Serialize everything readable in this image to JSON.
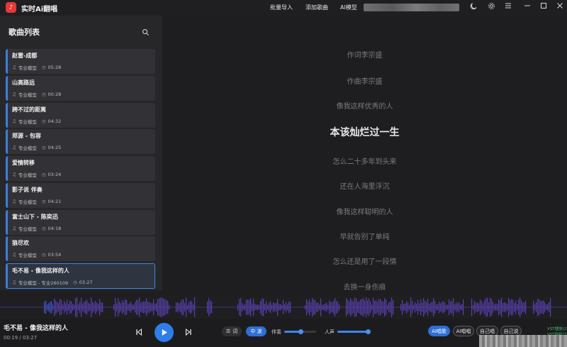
{
  "app": {
    "title": "实时Ai翻唱",
    "menu": [
      "批量导入",
      "添加歌曲",
      "AI模型"
    ]
  },
  "sidebar": {
    "title": "歌曲列表",
    "songs": [
      {
        "name": "赵雷-成都",
        "model": "专业模型",
        "duration": "05:28"
      },
      {
        "name": "山高路远",
        "model": "专业模型",
        "duration": "00:28"
      },
      {
        "name": "跨不过的距离",
        "model": "专业模型",
        "duration": "04:32"
      },
      {
        "name": "郑源 - 包容",
        "model": "专业模型",
        "duration": "04:25"
      },
      {
        "name": "爱情转移",
        "model": "专业模型",
        "duration": "03:24"
      },
      {
        "name": "影子说 伴奏",
        "model": "专业模型",
        "duration": "04:21"
      },
      {
        "name": "富士山下 - 陈奕迅",
        "model": "专业模型",
        "duration": "04:18"
      },
      {
        "name": "狼尽欢",
        "model": "专业模型",
        "duration": "03:54"
      },
      {
        "name": "毛不易 - 像我这样的人",
        "model": "专业模型 - 专业260109",
        "duration": "03:27"
      }
    ]
  },
  "lyrics": {
    "lines": [
      "作词李宗盛",
      "作曲李宗盛",
      "像我这样优秀的人",
      "本该灿烂过一生",
      "怎么二十多年到头来",
      "还在人海里浮沉",
      "像我这样聪明的人",
      "早就告别了单纯",
      "怎么还是用了一段情",
      "去换一身伤痕"
    ]
  },
  "player": {
    "title": "毛不易 - 像我这样的人",
    "time": "00:19 / 03:27",
    "progress": 0.092,
    "lyric_toggle": "词",
    "mid_toggle": "中 波",
    "accompaniment_label": "伴奏",
    "accompaniment_level": 0.5,
    "vocal_label": "人声",
    "vocal_level": 1.0,
    "modes": [
      "AI唱歌",
      "AI唱唱",
      "自己唱",
      "自己说"
    ],
    "active_mode": "AI唱歌",
    "vst_lines": [
      "VST播放(2)",
      "VST监听(2)"
    ]
  },
  "colors": {
    "accent": "#2f7de8",
    "wave_played": "#3f55c9",
    "wave_unplayed": "#5b3fb0",
    "vst_green": "#41b86a"
  }
}
